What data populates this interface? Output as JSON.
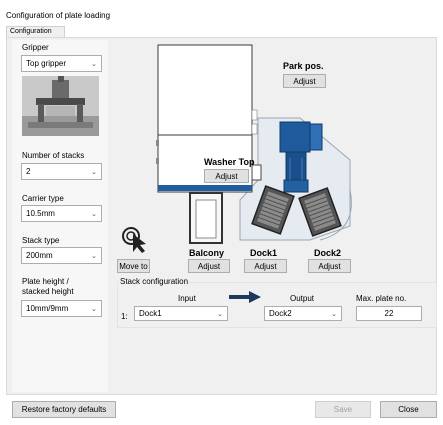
{
  "window": {
    "title": "Configuration of plate loading"
  },
  "tabs": [
    {
      "label": "Configuration"
    }
  ],
  "left": {
    "gripper": {
      "label": "Gripper",
      "value": "Top gripper"
    },
    "number_of_stacks": {
      "label": "Number of stacks",
      "value": "2"
    },
    "carrier_type": {
      "label": "Carrier type",
      "value": "10.5mm"
    },
    "stack_type": {
      "label": "Stack type",
      "value": "200mm"
    },
    "plate_height": {
      "label_line1": "Plate height /",
      "label_line2": "stacked height",
      "value": "10mm/9mm"
    }
  },
  "move_to": {
    "label": "Move to"
  },
  "positions": {
    "park": {
      "title": "Park pos.",
      "adjust": "Adjust"
    },
    "washer_top": {
      "title": "Washer Top",
      "adjust": "Adjust"
    },
    "balcony": {
      "title": "Balcony",
      "adjust": "Adjust"
    },
    "dock1": {
      "title": "Dock1",
      "adjust": "Adjust"
    },
    "dock2": {
      "title": "Dock2",
      "adjust": "Adjust"
    }
  },
  "stack_config": {
    "title": "Stack configuration",
    "input_header": "Input",
    "output_header": "Output",
    "max_header": "Max. plate no.",
    "rows": [
      {
        "index": "1:",
        "input": "Dock1",
        "output": "Dock2",
        "max": "22"
      }
    ]
  },
  "footer": {
    "restore_label": "Restore factory defaults",
    "save_label": "Save",
    "close_label": "Close"
  },
  "colors": {
    "accent": "#1f5f9e",
    "robot": "#1e5a9c",
    "dark": "#1b3a5c"
  }
}
